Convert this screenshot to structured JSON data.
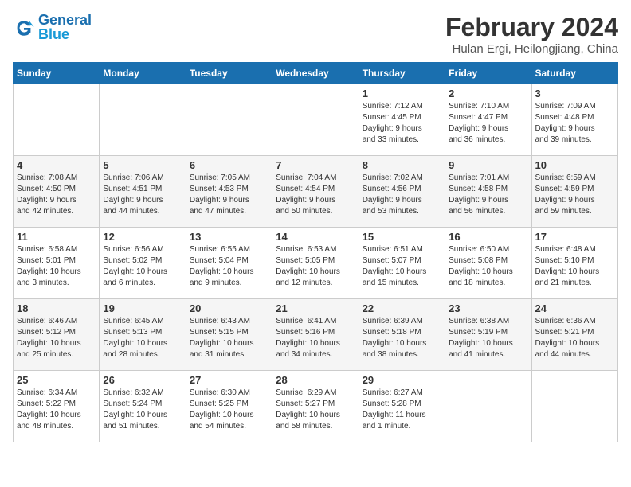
{
  "header": {
    "logo_line1": "General",
    "logo_line2": "Blue",
    "title": "February 2024",
    "subtitle": "Hulan Ergi, Heilongjiang, China"
  },
  "weekdays": [
    "Sunday",
    "Monday",
    "Tuesday",
    "Wednesday",
    "Thursday",
    "Friday",
    "Saturday"
  ],
  "weeks": [
    [
      {
        "day": "",
        "info": ""
      },
      {
        "day": "",
        "info": ""
      },
      {
        "day": "",
        "info": ""
      },
      {
        "day": "",
        "info": ""
      },
      {
        "day": "1",
        "info": "Sunrise: 7:12 AM\nSunset: 4:45 PM\nDaylight: 9 hours\nand 33 minutes."
      },
      {
        "day": "2",
        "info": "Sunrise: 7:10 AM\nSunset: 4:47 PM\nDaylight: 9 hours\nand 36 minutes."
      },
      {
        "day": "3",
        "info": "Sunrise: 7:09 AM\nSunset: 4:48 PM\nDaylight: 9 hours\nand 39 minutes."
      }
    ],
    [
      {
        "day": "4",
        "info": "Sunrise: 7:08 AM\nSunset: 4:50 PM\nDaylight: 9 hours\nand 42 minutes."
      },
      {
        "day": "5",
        "info": "Sunrise: 7:06 AM\nSunset: 4:51 PM\nDaylight: 9 hours\nand 44 minutes."
      },
      {
        "day": "6",
        "info": "Sunrise: 7:05 AM\nSunset: 4:53 PM\nDaylight: 9 hours\nand 47 minutes."
      },
      {
        "day": "7",
        "info": "Sunrise: 7:04 AM\nSunset: 4:54 PM\nDaylight: 9 hours\nand 50 minutes."
      },
      {
        "day": "8",
        "info": "Sunrise: 7:02 AM\nSunset: 4:56 PM\nDaylight: 9 hours\nand 53 minutes."
      },
      {
        "day": "9",
        "info": "Sunrise: 7:01 AM\nSunset: 4:58 PM\nDaylight: 9 hours\nand 56 minutes."
      },
      {
        "day": "10",
        "info": "Sunrise: 6:59 AM\nSunset: 4:59 PM\nDaylight: 9 hours\nand 59 minutes."
      }
    ],
    [
      {
        "day": "11",
        "info": "Sunrise: 6:58 AM\nSunset: 5:01 PM\nDaylight: 10 hours\nand 3 minutes."
      },
      {
        "day": "12",
        "info": "Sunrise: 6:56 AM\nSunset: 5:02 PM\nDaylight: 10 hours\nand 6 minutes."
      },
      {
        "day": "13",
        "info": "Sunrise: 6:55 AM\nSunset: 5:04 PM\nDaylight: 10 hours\nand 9 minutes."
      },
      {
        "day": "14",
        "info": "Sunrise: 6:53 AM\nSunset: 5:05 PM\nDaylight: 10 hours\nand 12 minutes."
      },
      {
        "day": "15",
        "info": "Sunrise: 6:51 AM\nSunset: 5:07 PM\nDaylight: 10 hours\nand 15 minutes."
      },
      {
        "day": "16",
        "info": "Sunrise: 6:50 AM\nSunset: 5:08 PM\nDaylight: 10 hours\nand 18 minutes."
      },
      {
        "day": "17",
        "info": "Sunrise: 6:48 AM\nSunset: 5:10 PM\nDaylight: 10 hours\nand 21 minutes."
      }
    ],
    [
      {
        "day": "18",
        "info": "Sunrise: 6:46 AM\nSunset: 5:12 PM\nDaylight: 10 hours\nand 25 minutes."
      },
      {
        "day": "19",
        "info": "Sunrise: 6:45 AM\nSunset: 5:13 PM\nDaylight: 10 hours\nand 28 minutes."
      },
      {
        "day": "20",
        "info": "Sunrise: 6:43 AM\nSunset: 5:15 PM\nDaylight: 10 hours\nand 31 minutes."
      },
      {
        "day": "21",
        "info": "Sunrise: 6:41 AM\nSunset: 5:16 PM\nDaylight: 10 hours\nand 34 minutes."
      },
      {
        "day": "22",
        "info": "Sunrise: 6:39 AM\nSunset: 5:18 PM\nDaylight: 10 hours\nand 38 minutes."
      },
      {
        "day": "23",
        "info": "Sunrise: 6:38 AM\nSunset: 5:19 PM\nDaylight: 10 hours\nand 41 minutes."
      },
      {
        "day": "24",
        "info": "Sunrise: 6:36 AM\nSunset: 5:21 PM\nDaylight: 10 hours\nand 44 minutes."
      }
    ],
    [
      {
        "day": "25",
        "info": "Sunrise: 6:34 AM\nSunset: 5:22 PM\nDaylight: 10 hours\nand 48 minutes."
      },
      {
        "day": "26",
        "info": "Sunrise: 6:32 AM\nSunset: 5:24 PM\nDaylight: 10 hours\nand 51 minutes."
      },
      {
        "day": "27",
        "info": "Sunrise: 6:30 AM\nSunset: 5:25 PM\nDaylight: 10 hours\nand 54 minutes."
      },
      {
        "day": "28",
        "info": "Sunrise: 6:29 AM\nSunset: 5:27 PM\nDaylight: 10 hours\nand 58 minutes."
      },
      {
        "day": "29",
        "info": "Sunrise: 6:27 AM\nSunset: 5:28 PM\nDaylight: 11 hours\nand 1 minute."
      },
      {
        "day": "",
        "info": ""
      },
      {
        "day": "",
        "info": ""
      }
    ]
  ]
}
